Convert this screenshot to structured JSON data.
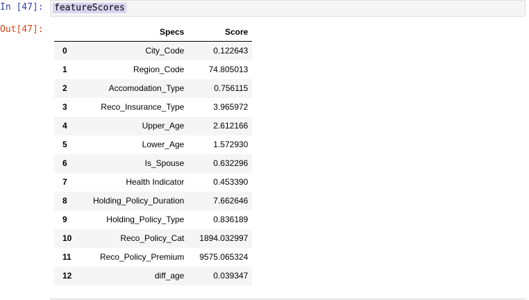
{
  "input_cell": {
    "prompt": "In [47]:",
    "code": "featureScores"
  },
  "output_cell": {
    "prompt": "Out[47]:",
    "table": {
      "columns": [
        "",
        "Specs",
        "Score"
      ],
      "rows": [
        {
          "index": "0",
          "specs": "City_Code",
          "score": "0.122643"
        },
        {
          "index": "1",
          "specs": "Region_Code",
          "score": "74.805013"
        },
        {
          "index": "2",
          "specs": "Accomodation_Type",
          "score": "0.756115"
        },
        {
          "index": "3",
          "specs": "Reco_Insurance_Type",
          "score": "3.965972"
        },
        {
          "index": "4",
          "specs": "Upper_Age",
          "score": "2.612166"
        },
        {
          "index": "5",
          "specs": "Lower_Age",
          "score": "1.572930"
        },
        {
          "index": "6",
          "specs": "Is_Spouse",
          "score": "0.632296"
        },
        {
          "index": "7",
          "specs": "Health Indicator",
          "score": "0.453390"
        },
        {
          "index": "8",
          "specs": "Holding_Policy_Duration",
          "score": "7.662646"
        },
        {
          "index": "9",
          "specs": "Holding_Policy_Type",
          "score": "0.836189"
        },
        {
          "index": "10",
          "specs": "Reco_Policy_Cat",
          "score": "1894.032997"
        },
        {
          "index": "11",
          "specs": "Reco_Policy_Premium",
          "score": "9575.065324"
        },
        {
          "index": "12",
          "specs": "diff_age",
          "score": "0.039347"
        }
      ]
    }
  }
}
